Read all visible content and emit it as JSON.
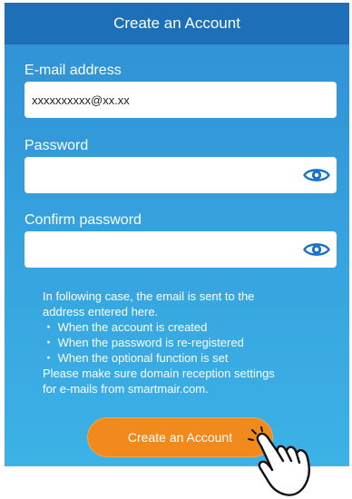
{
  "header": {
    "title": "Create an Account"
  },
  "email": {
    "label": "E-mail address",
    "value": "xxxxxxxxxx@xx.xx"
  },
  "password": {
    "label": "Password",
    "value": "",
    "reveal_icon": "eye-icon"
  },
  "confirm_password": {
    "label": "Confirm password",
    "value": "",
    "reveal_icon": "eye-icon"
  },
  "notice": {
    "intro_line1": "In following case, the email is sent to the",
    "intro_line2": "address entered here.",
    "bullets": [
      "・ When the account is created",
      "・ When the password is re-registered",
      "・ When the optional function is set"
    ],
    "outro_line1": "Please make sure domain reception settings",
    "outro_line2": "for e-mails from smartmair.com."
  },
  "actions": {
    "create_label": "Create an Account"
  },
  "pointer_icon": "tapping-hand-icon",
  "colors": {
    "header_bg": "#1d6fb8",
    "body_gradient_top": "#2f8fd3",
    "body_gradient_bottom": "#3cb2e6",
    "button_bg": "#f08a1c",
    "eye_icon": "#1a73c9"
  }
}
